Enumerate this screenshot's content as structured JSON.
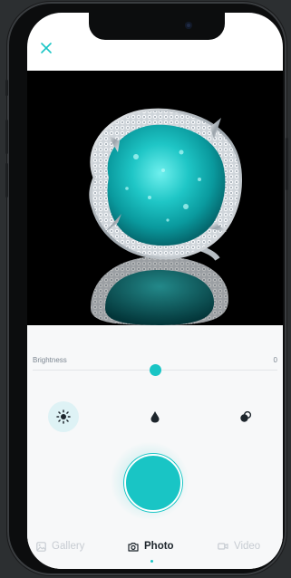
{
  "controls": {
    "brightness_label": "Brightness",
    "brightness_value": "0",
    "brightness_level": 0.5
  },
  "tabs": {
    "gallery": "Gallery",
    "photo": "Photo",
    "video": "Video",
    "active": "photo"
  },
  "icons": {
    "close": "close-icon",
    "brightness": "sun-icon",
    "contrast": "drop-icon",
    "saturation": "circles-icon",
    "gallery": "image-icon",
    "photo": "camera-icon",
    "video": "video-icon"
  },
  "colors": {
    "accent": "#19c5c5",
    "accent_light": "#def2f5",
    "muted": "#c7ccd2",
    "dark": "#1d252c"
  }
}
